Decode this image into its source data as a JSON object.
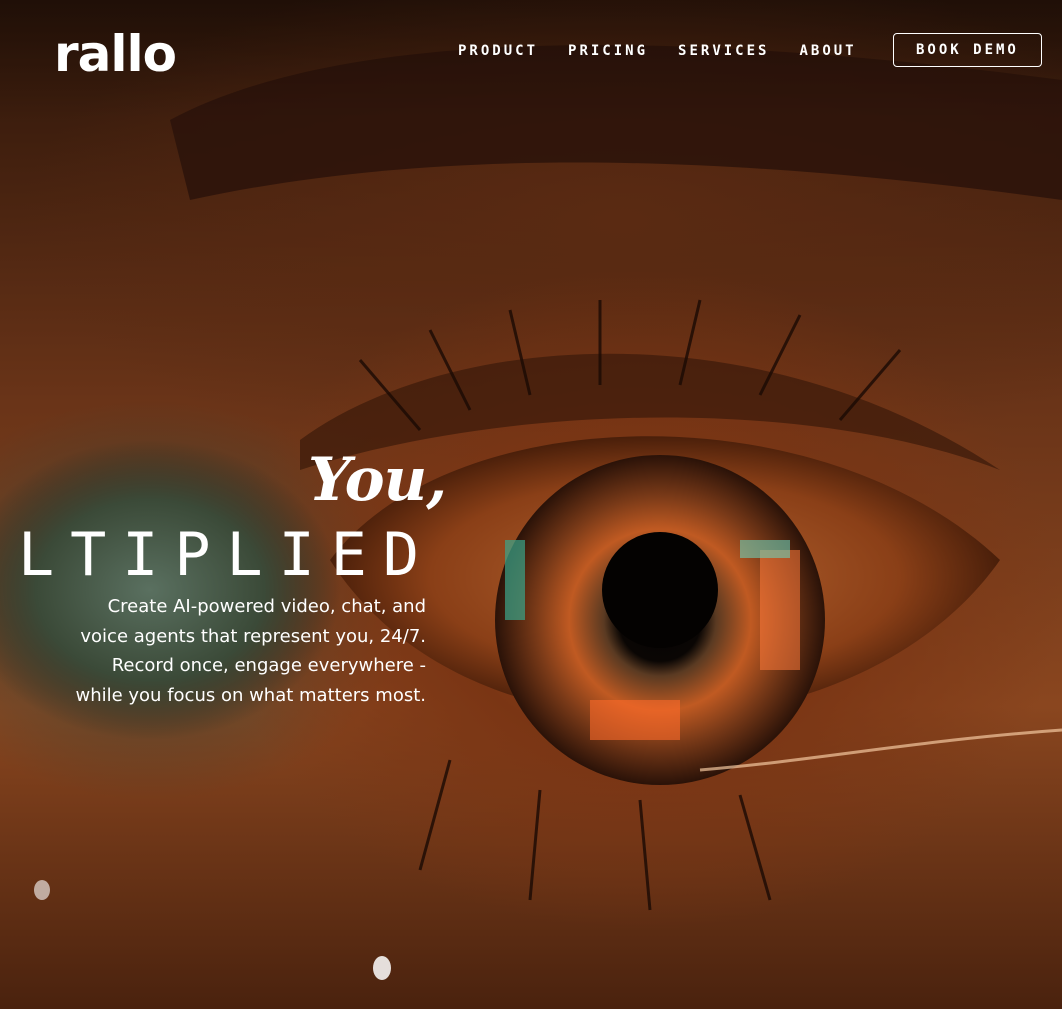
{
  "brand": {
    "logo_text": "rallo"
  },
  "nav": {
    "items": [
      {
        "label": "PRODUCT"
      },
      {
        "label": "PRICING"
      },
      {
        "label": "SERVICES"
      },
      {
        "label": "ABOUT"
      }
    ],
    "cta_label": "BOOK DEMO"
  },
  "hero": {
    "headline_top": "You,",
    "headline_bottom": "LTIPLIED",
    "subtitle_lines": [
      "Create AI-powered video, chat, and",
      "voice agents that represent you, 24/7.",
      "Record once, engage everywhere -",
      "while you focus on what matters most."
    ],
    "background": "eye-closeup-image"
  },
  "colors": {
    "text": "#ffffff",
    "tone": "#8a461f"
  }
}
